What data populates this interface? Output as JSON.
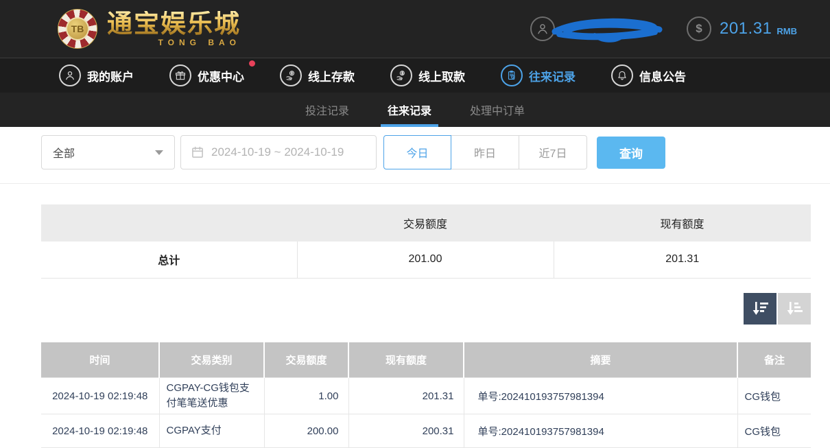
{
  "header": {
    "logo": {
      "tb": "TB",
      "title": "通宝娱乐城",
      "subtitle": "TONG BAO"
    },
    "balance": {
      "amount": "201.31",
      "currency": "RMB"
    },
    "icons": {
      "dollar": "$"
    }
  },
  "nav": {
    "items": [
      {
        "label": "我的账户",
        "active": false,
        "badge": false
      },
      {
        "label": "优惠中心",
        "active": false,
        "badge": true
      },
      {
        "label": "线上存款",
        "active": false,
        "badge": false
      },
      {
        "label": "线上取款",
        "active": false,
        "badge": false
      },
      {
        "label": "往来记录",
        "active": true,
        "badge": false
      },
      {
        "label": "信息公告",
        "active": false,
        "badge": false
      }
    ]
  },
  "subtabs": {
    "items": [
      {
        "label": "投注记录",
        "active": false
      },
      {
        "label": "往来记录",
        "active": true
      },
      {
        "label": "处理中订单",
        "active": false
      }
    ]
  },
  "filters": {
    "type_select": {
      "value": "全部"
    },
    "date_range": {
      "value": "2024-10-19 ~ 2024-10-19"
    },
    "quick_ranges": [
      {
        "label": "今日",
        "active": true
      },
      {
        "label": "昨日",
        "active": false
      },
      {
        "label": "近7日",
        "active": false
      }
    ],
    "search_label": "查询"
  },
  "summary_table": {
    "headers": [
      "",
      "交易额度",
      "现有额度"
    ],
    "row": {
      "label": "总计",
      "transaction_amount": "201.00",
      "current_amount": "201.31"
    }
  },
  "records_table": {
    "headers": [
      "时间",
      "交易类别",
      "交易额度",
      "现有额度",
      "摘要",
      "备注"
    ],
    "rows": [
      {
        "time": "2024-10-19 02:19:48",
        "type": "CGPAY-CG钱包支付笔笔送优惠",
        "amount": "1.00",
        "balance": "201.31",
        "summary": "单号:202410193757981394",
        "remark": "CG钱包"
      },
      {
        "time": "2024-10-19 02:19:48",
        "type": "CGPAY支付",
        "amount": "200.00",
        "balance": "200.31",
        "summary": "单号:202410193757981394",
        "remark": "CG钱包"
      }
    ]
  },
  "colors": {
    "accent_blue": "#4da3e8",
    "query_button": "#5bb8f0",
    "badge_red": "#e8415a",
    "table_header_gray": "#c4c4c4",
    "sort_active_bg": "#3f4e63",
    "header_dark": "#232323"
  }
}
